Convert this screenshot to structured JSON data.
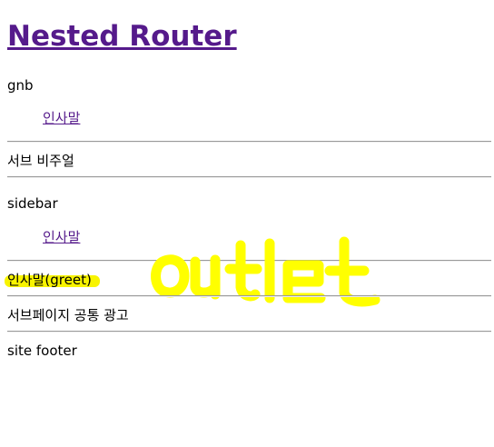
{
  "header": {
    "title": "Nested Router"
  },
  "gnb": {
    "label": "gnb",
    "link": "인사말"
  },
  "sub_visual": {
    "label": "서브 비주얼"
  },
  "sidebar": {
    "label": "sidebar",
    "link": "인사말"
  },
  "outlet": {
    "content": "인사말(greet)",
    "annotation": "outlet",
    "annotation_color": "#ffff00"
  },
  "sub_ad": {
    "label": "서브페이지 공통 광고"
  },
  "footer": {
    "label": "site footer"
  },
  "colors": {
    "link": "#551a8b",
    "divider": "#9a9a9a",
    "highlight": "#f8f400"
  }
}
